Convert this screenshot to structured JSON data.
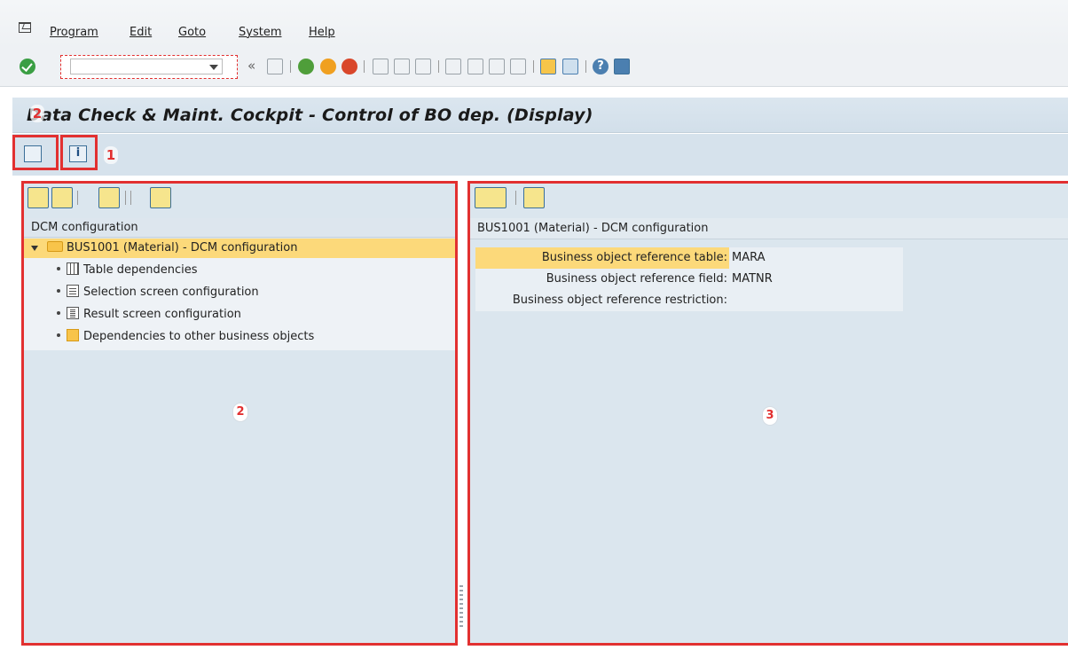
{
  "menu": {
    "items": [
      "Program",
      "Edit",
      "Goto",
      "System",
      "Help"
    ]
  },
  "toolbar": {
    "command_value": "",
    "chevron": "«"
  },
  "title": {
    "text": "Data Check & Maint. Cockpit - Control of BO dep. (Display)",
    "marker": "2"
  },
  "app_toolbar": {
    "marker": "1"
  },
  "left_panel": {
    "header": "DCM configuration",
    "root_node": "BUS1001 (Material) - DCM configuration",
    "children": [
      {
        "label": "Table dependencies",
        "icon": "table-icon"
      },
      {
        "label": "Selection screen configuration",
        "icon": "selection-screen-icon"
      },
      {
        "label": "Result screen configuration",
        "icon": "result-screen-icon"
      },
      {
        "label": "Dependencies to other business objects",
        "icon": "dependency-icon"
      }
    ],
    "marker": "2"
  },
  "right_panel": {
    "header": "BUS1001 (Material) - DCM configuration",
    "fields": [
      {
        "label": "Business object reference table:",
        "value": "MARA"
      },
      {
        "label": "Business object reference field:",
        "value": "MATNR"
      },
      {
        "label": "Business object reference restriction:",
        "value": ""
      }
    ],
    "marker": "3"
  },
  "colors": {
    "annotation_red": "#e23030",
    "selection_yellow": "#fcd97a",
    "panel_bg": "#dbe6ee",
    "title_bg": "#d2dfea"
  }
}
